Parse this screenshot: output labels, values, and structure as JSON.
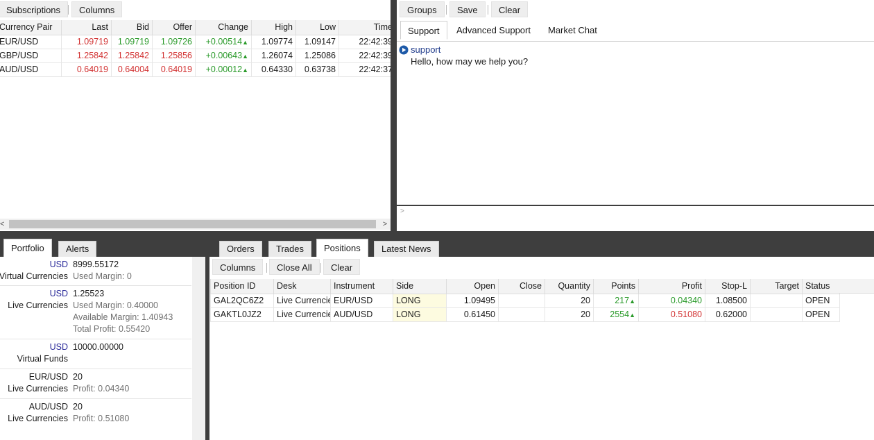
{
  "quotes": {
    "toolbar": {
      "subscriptions": "Subscriptions",
      "columns": "Columns"
    },
    "headers": [
      "Currency Pair",
      "Last",
      "Bid",
      "Offer",
      "Change",
      "High",
      "Low",
      "Time"
    ],
    "rows": [
      {
        "pair": "EUR/USD",
        "last": "1.09719",
        "bid": "1.09719",
        "offer": "1.09726",
        "change": "+0.00514",
        "arrow": "▲",
        "high": "1.09774",
        "low": "1.09147",
        "time": "22:42:39"
      },
      {
        "pair": "GBP/USD",
        "last": "1.25842",
        "bid": "1.25842",
        "offer": "1.25856",
        "change": "+0.00643",
        "arrow": "▲",
        "high": "1.26074",
        "low": "1.25086",
        "time": "22:42:39"
      },
      {
        "pair": "AUD/USD",
        "last": "0.64019",
        "bid": "0.64004",
        "offer": "0.64019",
        "change": "+0.00012",
        "arrow": "▲",
        "high": "0.64330",
        "low": "0.63738",
        "time": "22:42:37"
      }
    ],
    "scroll_left": "<",
    "scroll_right": ">"
  },
  "chat": {
    "toolbar": {
      "groups": "Groups",
      "save": "Save",
      "clear": "Clear"
    },
    "tabs": [
      "Support",
      "Advanced Support",
      "Market Chat"
    ],
    "message": {
      "sender": "support",
      "text": "Hello, how may we help you?"
    },
    "input_prompt": ">"
  },
  "portfolio": {
    "tabs": [
      "Portfolio",
      "Alerts"
    ],
    "accounts": [
      {
        "currency": "USD",
        "value": "8999.55172",
        "name": "Virtual Currencies",
        "details": [
          {
            "k": "Used Margin:",
            "v": "0"
          }
        ]
      },
      {
        "currency": "USD",
        "value": "1.25523",
        "name": "Live Currencies",
        "details": [
          {
            "k": "Used Margin:",
            "v": "0.40000"
          },
          {
            "k": "Available Margin:",
            "v": "1.40943"
          },
          {
            "k": "Total Profit:",
            "v": "0.55420"
          }
        ]
      },
      {
        "currency": "USD",
        "value": "10000.00000",
        "name": "Virtual Funds",
        "details": []
      },
      {
        "currency": "EUR/USD",
        "value": "20",
        "name": "Live Currencies",
        "details": [
          {
            "k": "Profit:",
            "v": "0.04340"
          }
        ]
      },
      {
        "currency": "AUD/USD",
        "value": "20",
        "name": "Live Currencies",
        "details": [
          {
            "k": "Profit:",
            "v": "0.51080"
          }
        ]
      }
    ]
  },
  "positions": {
    "tabs": [
      "Orders",
      "Trades",
      "Positions",
      "Latest News"
    ],
    "toolbar": {
      "columns": "Columns",
      "close_all": "Close All",
      "clear": "Clear"
    },
    "headers": [
      "Position ID",
      "Desk",
      "Instrument",
      "Side",
      "Open",
      "Close",
      "Quantity",
      "Points",
      "Profit",
      "Stop-L",
      "Target",
      "Status"
    ],
    "rows": [
      {
        "id": "GAL2QC6Z2",
        "desk": "Live Currencies",
        "instrument": "EUR/USD",
        "side": "LONG",
        "open": "1.09495",
        "close": "",
        "quantity": "20",
        "points": "217",
        "arrow": "▲",
        "profit": "0.04340",
        "stop": "1.08500",
        "target": "",
        "status": "OPEN"
      },
      {
        "id": "GAKTL0JZ2",
        "desk": "Live Currencies",
        "instrument": "AUD/USD",
        "side": "LONG",
        "open": "0.61450",
        "close": "",
        "quantity": "20",
        "points": "2554",
        "arrow": "▲",
        "profit": "0.51080",
        "stop": "0.62000",
        "target": "",
        "status": "OPEN"
      }
    ]
  },
  "colors": {
    "up": "#2a9a2a",
    "down": "#d23232",
    "frame": "#3e3e3e",
    "usd": "#2a2a9a"
  }
}
